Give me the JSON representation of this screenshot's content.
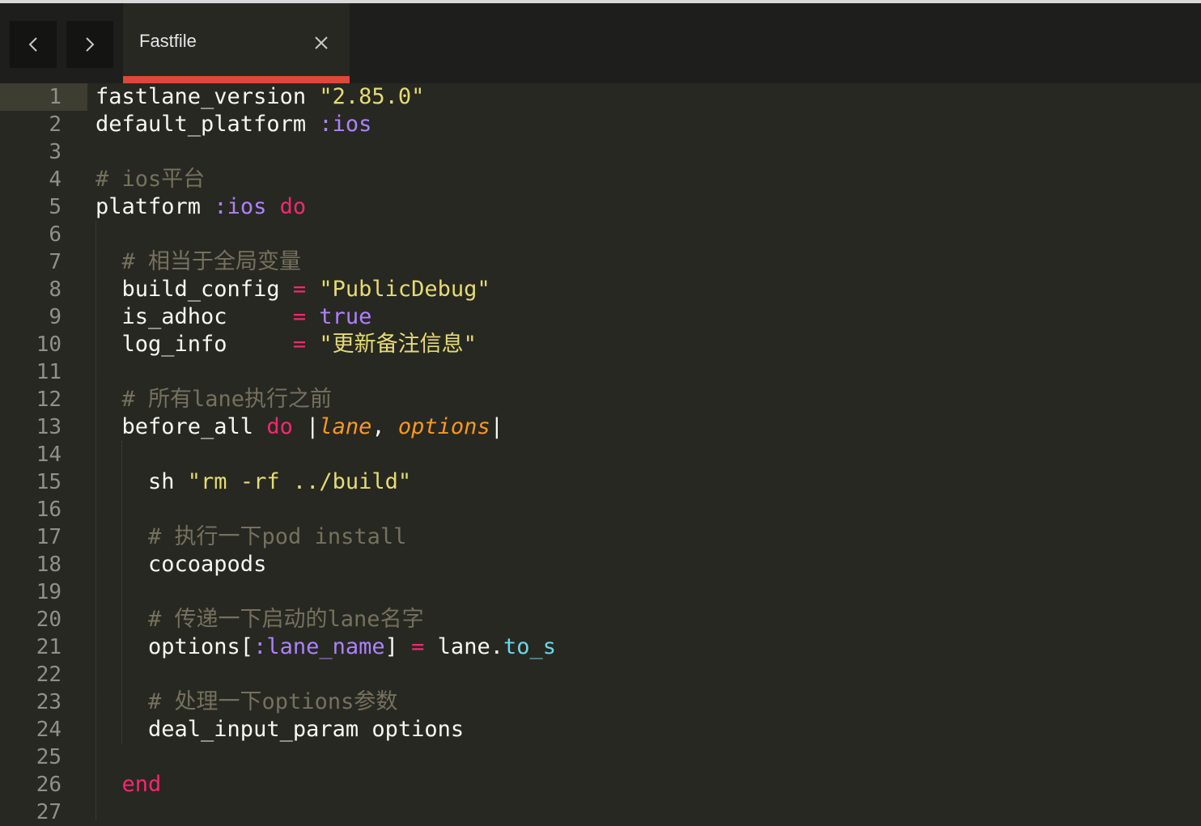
{
  "tabbar": {
    "back_label": "<",
    "forward_label": ">",
    "active_tab": "Fastfile",
    "accent_color": "#e0463a"
  },
  "editor": {
    "active_line": "1",
    "line_numbers": [
      "1",
      "2",
      "3",
      "4",
      "5",
      "6",
      "7",
      "8",
      "9",
      "10",
      "11",
      "12",
      "13",
      "14",
      "15",
      "16",
      "17",
      "18",
      "19",
      "20",
      "21",
      "22",
      "23",
      "24",
      "25",
      "26",
      "27"
    ],
    "lines": [
      [
        {
          "t": "fastlane_version ",
          "c": ""
        },
        {
          "t": "\"2.85.0\"",
          "c": "st"
        }
      ],
      [
        {
          "t": "default_platform ",
          "c": ""
        },
        {
          "t": ":ios",
          "c": "sy"
        }
      ],
      [],
      [
        {
          "t": "# ios平台",
          "c": "cm"
        }
      ],
      [
        {
          "t": "platform ",
          "c": ""
        },
        {
          "t": ":ios",
          "c": "sy"
        },
        {
          "t": " ",
          "c": ""
        },
        {
          "t": "do",
          "c": "kw"
        }
      ],
      [],
      [
        {
          "t": "  ",
          "c": ""
        },
        {
          "t": "# 相当于全局变量",
          "c": "cm"
        }
      ],
      [
        {
          "t": "  build_config ",
          "c": ""
        },
        {
          "t": "=",
          "c": "kw"
        },
        {
          "t": " ",
          "c": ""
        },
        {
          "t": "\"PublicDebug\"",
          "c": "st"
        }
      ],
      [
        {
          "t": "  is_adhoc     ",
          "c": ""
        },
        {
          "t": "=",
          "c": "kw"
        },
        {
          "t": " ",
          "c": ""
        },
        {
          "t": "true",
          "c": "sy"
        }
      ],
      [
        {
          "t": "  log_info     ",
          "c": ""
        },
        {
          "t": "=",
          "c": "kw"
        },
        {
          "t": " ",
          "c": ""
        },
        {
          "t": "\"更新备注信息\"",
          "c": "st"
        }
      ],
      [],
      [
        {
          "t": "  ",
          "c": ""
        },
        {
          "t": "# 所有lane执行之前",
          "c": "cm"
        }
      ],
      [
        {
          "t": "  before_all ",
          "c": ""
        },
        {
          "t": "do",
          "c": "kw"
        },
        {
          "t": " |",
          "c": ""
        },
        {
          "t": "lane",
          "c": "pa"
        },
        {
          "t": ", ",
          "c": ""
        },
        {
          "t": "options",
          "c": "pa"
        },
        {
          "t": "|",
          "c": ""
        }
      ],
      [],
      [
        {
          "t": "    sh ",
          "c": ""
        },
        {
          "t": "\"rm -rf ../build\"",
          "c": "st"
        }
      ],
      [],
      [
        {
          "t": "    ",
          "c": ""
        },
        {
          "t": "# 执行一下pod install",
          "c": "cm"
        }
      ],
      [
        {
          "t": "    cocoapods",
          "c": ""
        }
      ],
      [],
      [
        {
          "t": "    ",
          "c": ""
        },
        {
          "t": "# 传递一下启动的lane名字",
          "c": "cm"
        }
      ],
      [
        {
          "t": "    options[",
          "c": ""
        },
        {
          "t": ":lane_name",
          "c": "sy"
        },
        {
          "t": "] ",
          "c": ""
        },
        {
          "t": "=",
          "c": "kw"
        },
        {
          "t": " lane.",
          "c": ""
        },
        {
          "t": "to_s",
          "c": "fn"
        }
      ],
      [],
      [
        {
          "t": "    ",
          "c": ""
        },
        {
          "t": "# 处理一下options参数",
          "c": "cm"
        }
      ],
      [
        {
          "t": "    deal_input_param options",
          "c": ""
        }
      ],
      [],
      [
        {
          "t": "  ",
          "c": ""
        },
        {
          "t": "end",
          "c": "kw"
        }
      ],
      []
    ]
  }
}
